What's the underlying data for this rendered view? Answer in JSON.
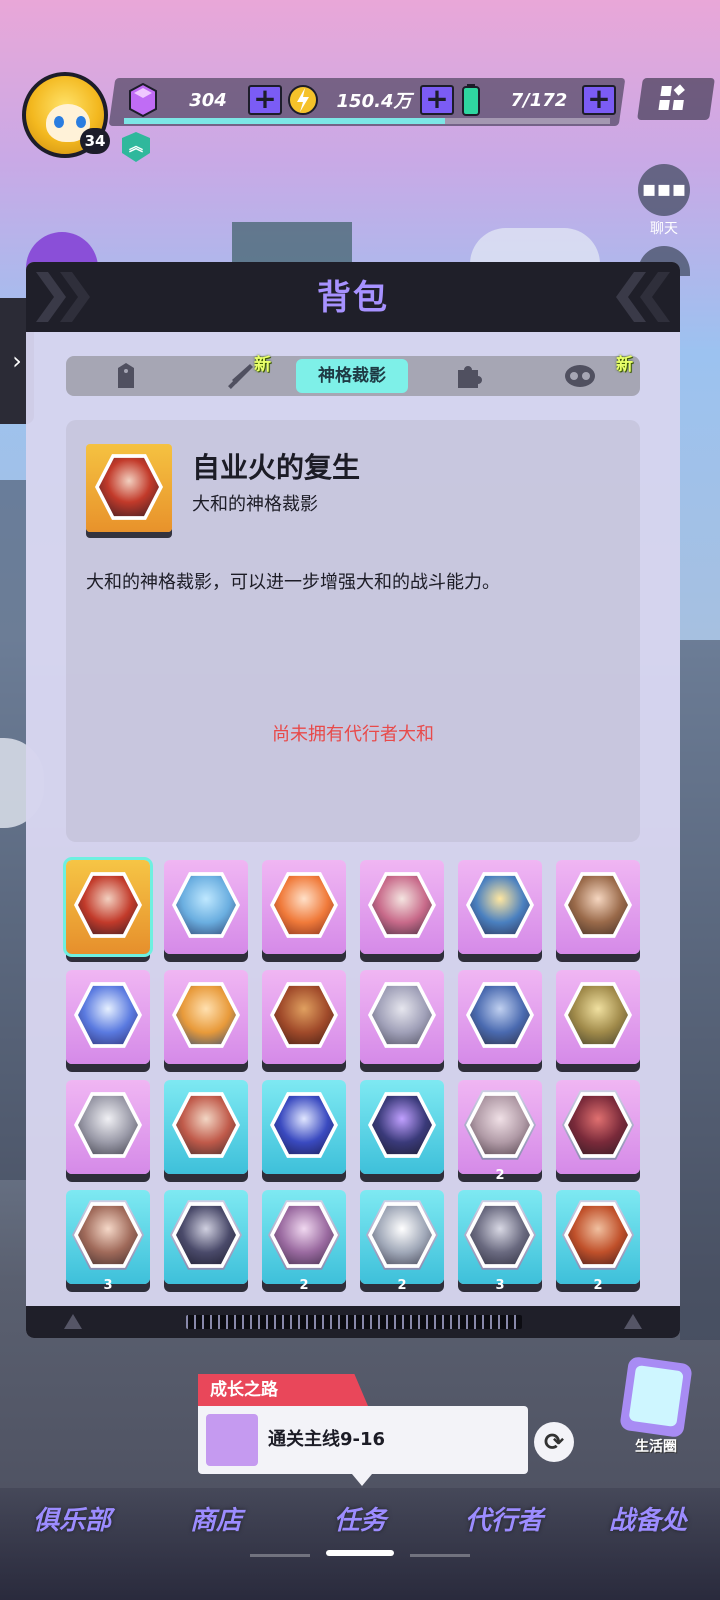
{
  "hud": {
    "level": "34",
    "gems": "304",
    "coins": "150.4万",
    "energy": "7/172",
    "chat_label": "聊天",
    "xp_progress": 0.66
  },
  "panel": {
    "title": "背包",
    "tabs": {
      "active_label": "神格裁影",
      "new_badge_1": "新",
      "new_badge_2": "新"
    }
  },
  "detail": {
    "item_name": "自业火的复生",
    "item_type": "大和的神格裁影",
    "description": "大和的神格裁影，可以进一步增强大和的战斗能力。",
    "warning": "尚未拥有代行者大和"
  },
  "items": [
    {
      "style": "gold",
      "count": ""
    },
    {
      "style": "purple",
      "count": ""
    },
    {
      "style": "purple",
      "count": ""
    },
    {
      "style": "purple",
      "count": ""
    },
    {
      "style": "purple",
      "count": ""
    },
    {
      "style": "purple",
      "count": ""
    },
    {
      "style": "purple",
      "count": ""
    },
    {
      "style": "purple",
      "count": ""
    },
    {
      "style": "purple",
      "count": ""
    },
    {
      "style": "purple",
      "count": ""
    },
    {
      "style": "purple",
      "count": ""
    },
    {
      "style": "purple",
      "count": ""
    },
    {
      "style": "purple",
      "count": ""
    },
    {
      "style": "teal",
      "count": ""
    },
    {
      "style": "teal",
      "count": ""
    },
    {
      "style": "teal",
      "count": ""
    },
    {
      "style": "purple-ring",
      "count": "2"
    },
    {
      "style": "purple-ring",
      "count": ""
    },
    {
      "style": "teal-ring",
      "count": "3"
    },
    {
      "style": "teal-ring",
      "count": ""
    },
    {
      "style": "teal-ring",
      "count": "2"
    },
    {
      "style": "teal-ring",
      "count": "2"
    },
    {
      "style": "teal-ring",
      "count": "3"
    },
    {
      "style": "teal-ring",
      "count": "2"
    }
  ],
  "quest": {
    "category": "成长之路",
    "task": "通关主线9-16"
  },
  "life_circle_label": "生活圈",
  "nav": {
    "club": "俱乐部",
    "shop": "商店",
    "tasks": "任务",
    "agents": "代行者",
    "armory": "战备处"
  },
  "colors": {
    "accent_purple": "#7b5cf5",
    "active_tab": "#7ef0e8",
    "warning_red": "#e84a4a",
    "quest_red": "#e9475a"
  }
}
